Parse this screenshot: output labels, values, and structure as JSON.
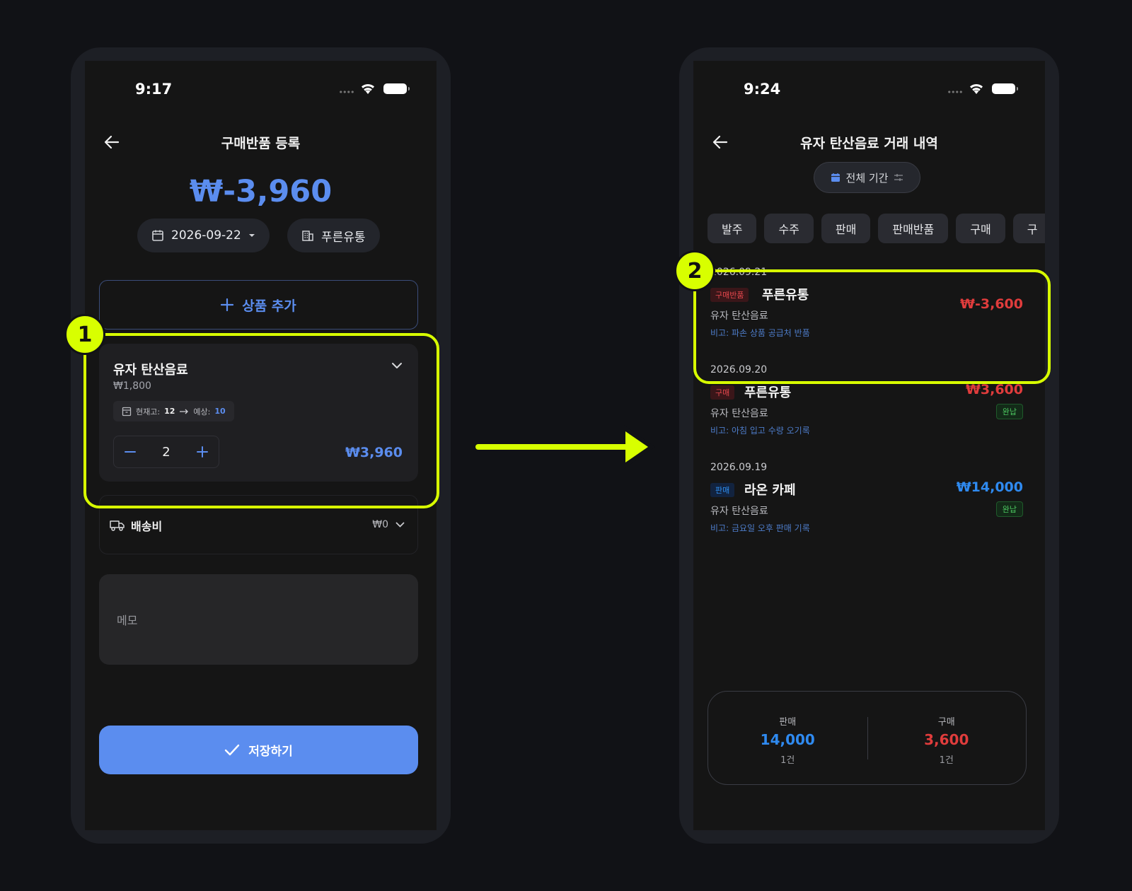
{
  "left": {
    "status": {
      "time": "9:17"
    },
    "title": "구매반품 등록",
    "total": "₩-3,960",
    "date": "2026-09-22",
    "supplier": "푸른유통",
    "add_product": "상품 추가",
    "product": {
      "name": "유자 탄산음료",
      "unit_price": "₩1,800",
      "stock_label": "현재고:",
      "stock_current": "12",
      "stock_expected_label": "예상:",
      "stock_expected": "10",
      "quantity": "2",
      "line_total": "₩3,960"
    },
    "shipping": {
      "label": "배송비",
      "value": "₩0"
    },
    "memo_placeholder": "메모",
    "save": "저장하기"
  },
  "right": {
    "status": {
      "time": "9:24"
    },
    "title": "유자 탄산음료 거래 내역",
    "period": "전체 기간",
    "filters": [
      "발주",
      "수주",
      "판매",
      "판매반품",
      "구매",
      "구"
    ],
    "transactions": [
      {
        "date": "2026.09.21",
        "type": "구매반품",
        "partner": "푸른유통",
        "item": "유자 탄산음료",
        "note": "비고: 파손 상품 공급처 반품",
        "amount": "₩-3,600",
        "paid": ""
      },
      {
        "date": "2026.09.20",
        "type": "구매",
        "partner": "푸른유통",
        "item": "유자 탄산음료",
        "note": "비고: 아침 입고 수량 오기록",
        "amount": "₩3,600",
        "paid": "완납"
      },
      {
        "date": "2026.09.19",
        "type": "판매",
        "partner": "라온 카페",
        "item": "유자 탄산음료",
        "note": "비고: 금요일 오후 판매 기록",
        "amount": "₩14,000",
        "paid": "완납"
      }
    ],
    "summary": {
      "sales_label": "판매",
      "sales_value": "14,000",
      "sales_count": "1건",
      "purchase_label": "구매",
      "purchase_value": "3,600",
      "purchase_count": "1건"
    }
  },
  "annotations": {
    "marker1": "1",
    "marker2": "2"
  },
  "colors": {
    "accent": "#5b8def",
    "highlight": "#d8ff00",
    "negative": "#e03c3c",
    "positive": "#2f8af0",
    "paid": "#4cc760"
  }
}
